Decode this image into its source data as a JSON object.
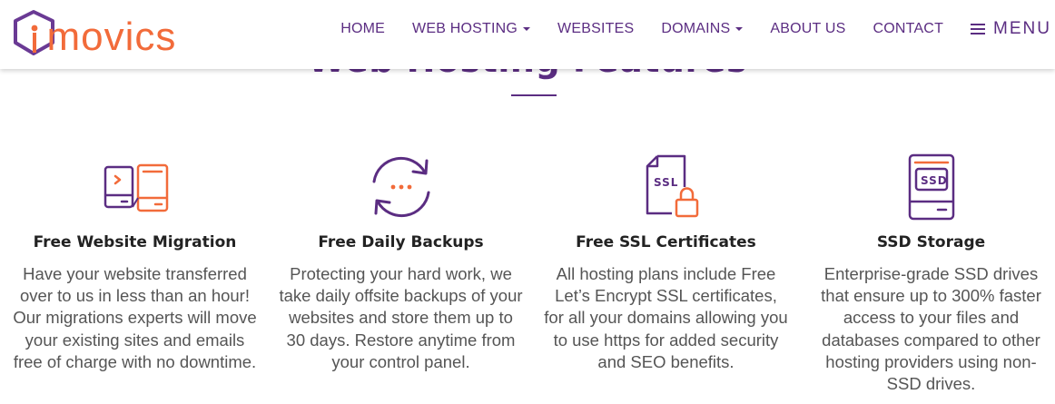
{
  "brand": {
    "name": "movics",
    "colors": {
      "primary": "#5b2d82",
      "accent": "#f26b3a",
      "text": "#222222",
      "muted": "#555555"
    }
  },
  "nav": {
    "items": [
      {
        "label": "HOME",
        "dropdown": false
      },
      {
        "label": "WEB HOSTING",
        "dropdown": true
      },
      {
        "label": "WEBSITES",
        "dropdown": false
      },
      {
        "label": "DOMAINS",
        "dropdown": true
      },
      {
        "label": "ABOUT US",
        "dropdown": false
      },
      {
        "label": "CONTACT",
        "dropdown": false
      }
    ],
    "menu_label": "MENU"
  },
  "section": {
    "title": "Web Hosting Features"
  },
  "features": [
    {
      "icon": "server-migration-icon",
      "title": "Free Website Migration",
      "description": "Have your website transferred over to us in less than an hour! Our migrations experts will move your existing sites and emails free of charge with no downtime."
    },
    {
      "icon": "backup-sync-icon",
      "title": "Free Daily Backups",
      "description": "Protecting your hard work, we take daily offsite backups of your websites and store them up to 30 days. Restore anytime from your control panel."
    },
    {
      "icon": "ssl-certificate-icon",
      "title": "Free SSL Certificates",
      "icon_text": "SSL",
      "description": "All hosting plans include Free Let’s Encrypt SSL certificates, for all your domains allowing you to use https for added security and SEO benefits."
    },
    {
      "icon": "ssd-drive-icon",
      "title": "SSD Storage",
      "icon_text": "SSD",
      "description": "Enterprise-grade SSD drives that ensure up to 300% faster access to your files and databases compared to other hosting providers using non-SSD drives."
    }
  ]
}
